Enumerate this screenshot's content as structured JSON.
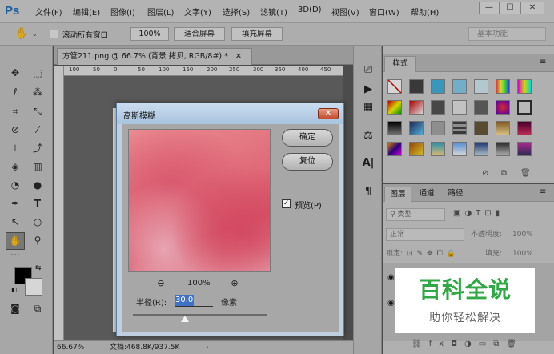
{
  "app": {
    "logo": "Ps"
  },
  "menu": [
    "文件(F)",
    "编辑(E)",
    "图像(I)",
    "图层(L)",
    "文字(Y)",
    "选择(S)",
    "滤镜(T)",
    "3D(D)",
    "视图(V)",
    "窗口(W)",
    "帮助(H)"
  ],
  "window_controls": [
    "—",
    "☐",
    "✕"
  ],
  "options_bar": {
    "scroll_all_windows": "滚动所有窗口",
    "zoom_100": "100%",
    "fit_screen": "适合屏幕",
    "fill_screen": "填充屏幕",
    "workspace": "基本功能"
  },
  "document": {
    "tab_title": "方管211.png @ 66.7% (背景 拷贝, RGB/8#) *",
    "tab_close": "✕",
    "ruler_ticks": [
      "100",
      "50",
      "0",
      "50",
      "100",
      "150",
      "200",
      "250",
      "300",
      "350",
      "400",
      "450"
    ],
    "status_zoom": "66.67%",
    "status_doc": "文档:468.8K/937.5K"
  },
  "styles_panel": {
    "tab": "样式"
  },
  "layers_panel": {
    "tabs": [
      "图层",
      "通道",
      "路径"
    ],
    "filter_kind": "类型",
    "blend_mode": "正常",
    "opacity_label": "不透明度:",
    "opacity_value": "100%",
    "lock_label": "锁定:",
    "fill_label": "填充:",
    "fill_value": "100%"
  },
  "dialog": {
    "title": "高斯模糊",
    "close": "✕",
    "ok": "确定",
    "reset": "复位",
    "preview_label": "预览(P)",
    "preview_checked": "✓",
    "zoom_level": "100%",
    "radius_label": "半径(R):",
    "radius_value": "30.0",
    "radius_unit": "像素"
  },
  "watermark": {
    "title": "百科全说",
    "subtitle": "助你轻松解决"
  }
}
